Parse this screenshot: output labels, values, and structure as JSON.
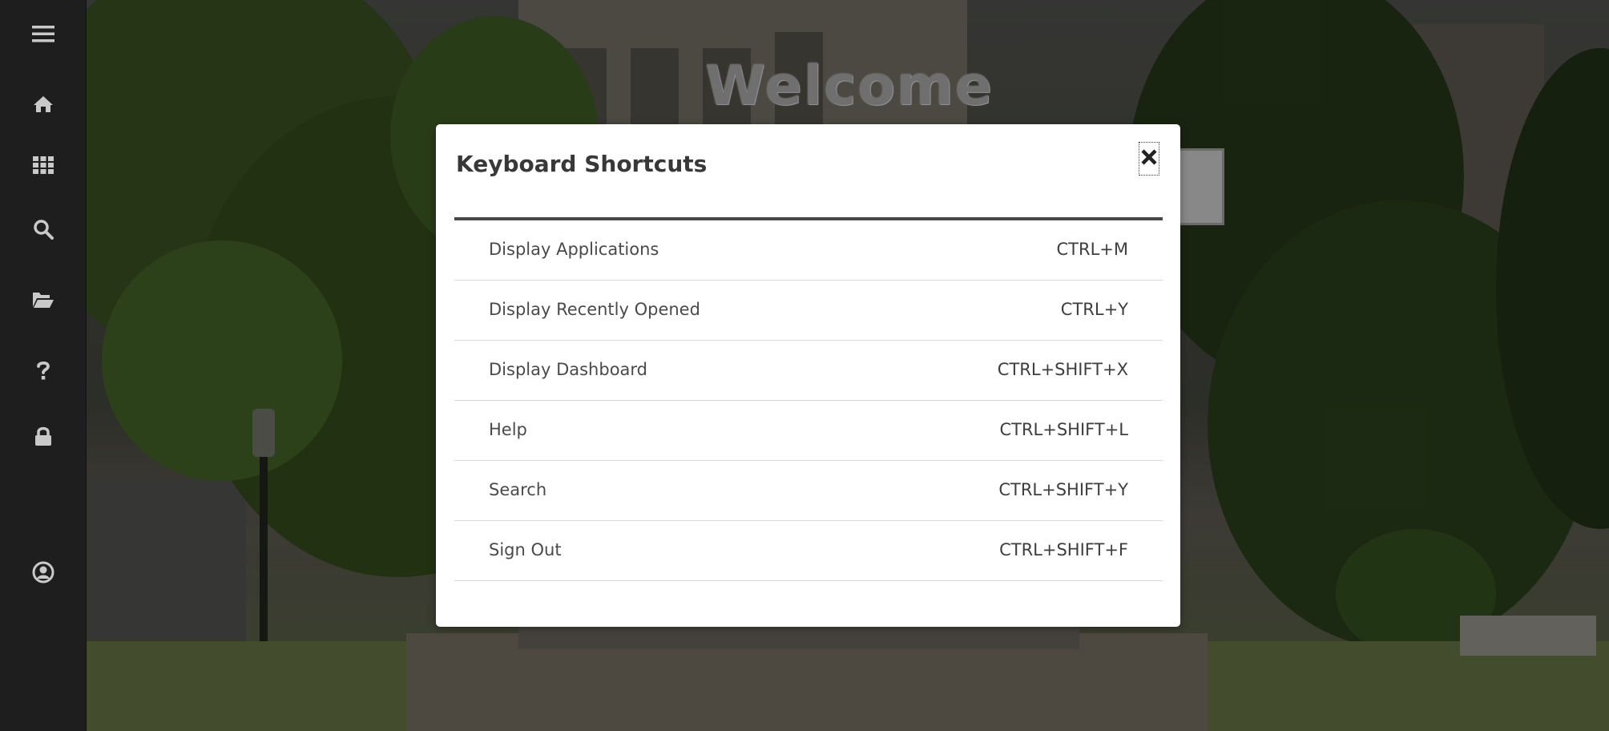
{
  "sidebar": {
    "items": [
      {
        "name": "menu",
        "icon": "hamburger-menu-icon"
      },
      {
        "name": "home",
        "icon": "home-icon"
      },
      {
        "name": "applications",
        "icon": "grid-icon"
      },
      {
        "name": "search",
        "icon": "search-icon"
      },
      {
        "name": "recently-opened",
        "icon": "folder-open-icon"
      },
      {
        "name": "help",
        "icon": "question-icon"
      },
      {
        "name": "sign-out",
        "icon": "lock-icon"
      },
      {
        "name": "user-profile",
        "icon": "user-circle-icon"
      }
    ],
    "icon_color": "#c9c9c9",
    "background": "#1e1e1f"
  },
  "page": {
    "welcome": "Welcome"
  },
  "modal": {
    "title": "Keyboard Shortcuts",
    "close_icon": "close-icon",
    "shortcuts": [
      {
        "action": "Display Applications",
        "keys": "CTRL+M"
      },
      {
        "action": "Display Recently Opened",
        "keys": "CTRL+Y"
      },
      {
        "action": "Display Dashboard",
        "keys": "CTRL+SHIFT+X"
      },
      {
        "action": "Help",
        "keys": "CTRL+SHIFT+L"
      },
      {
        "action": "Search",
        "keys": "CTRL+SHIFT+Y"
      },
      {
        "action": "Sign Out",
        "keys": "CTRL+SHIFT+F"
      }
    ]
  }
}
